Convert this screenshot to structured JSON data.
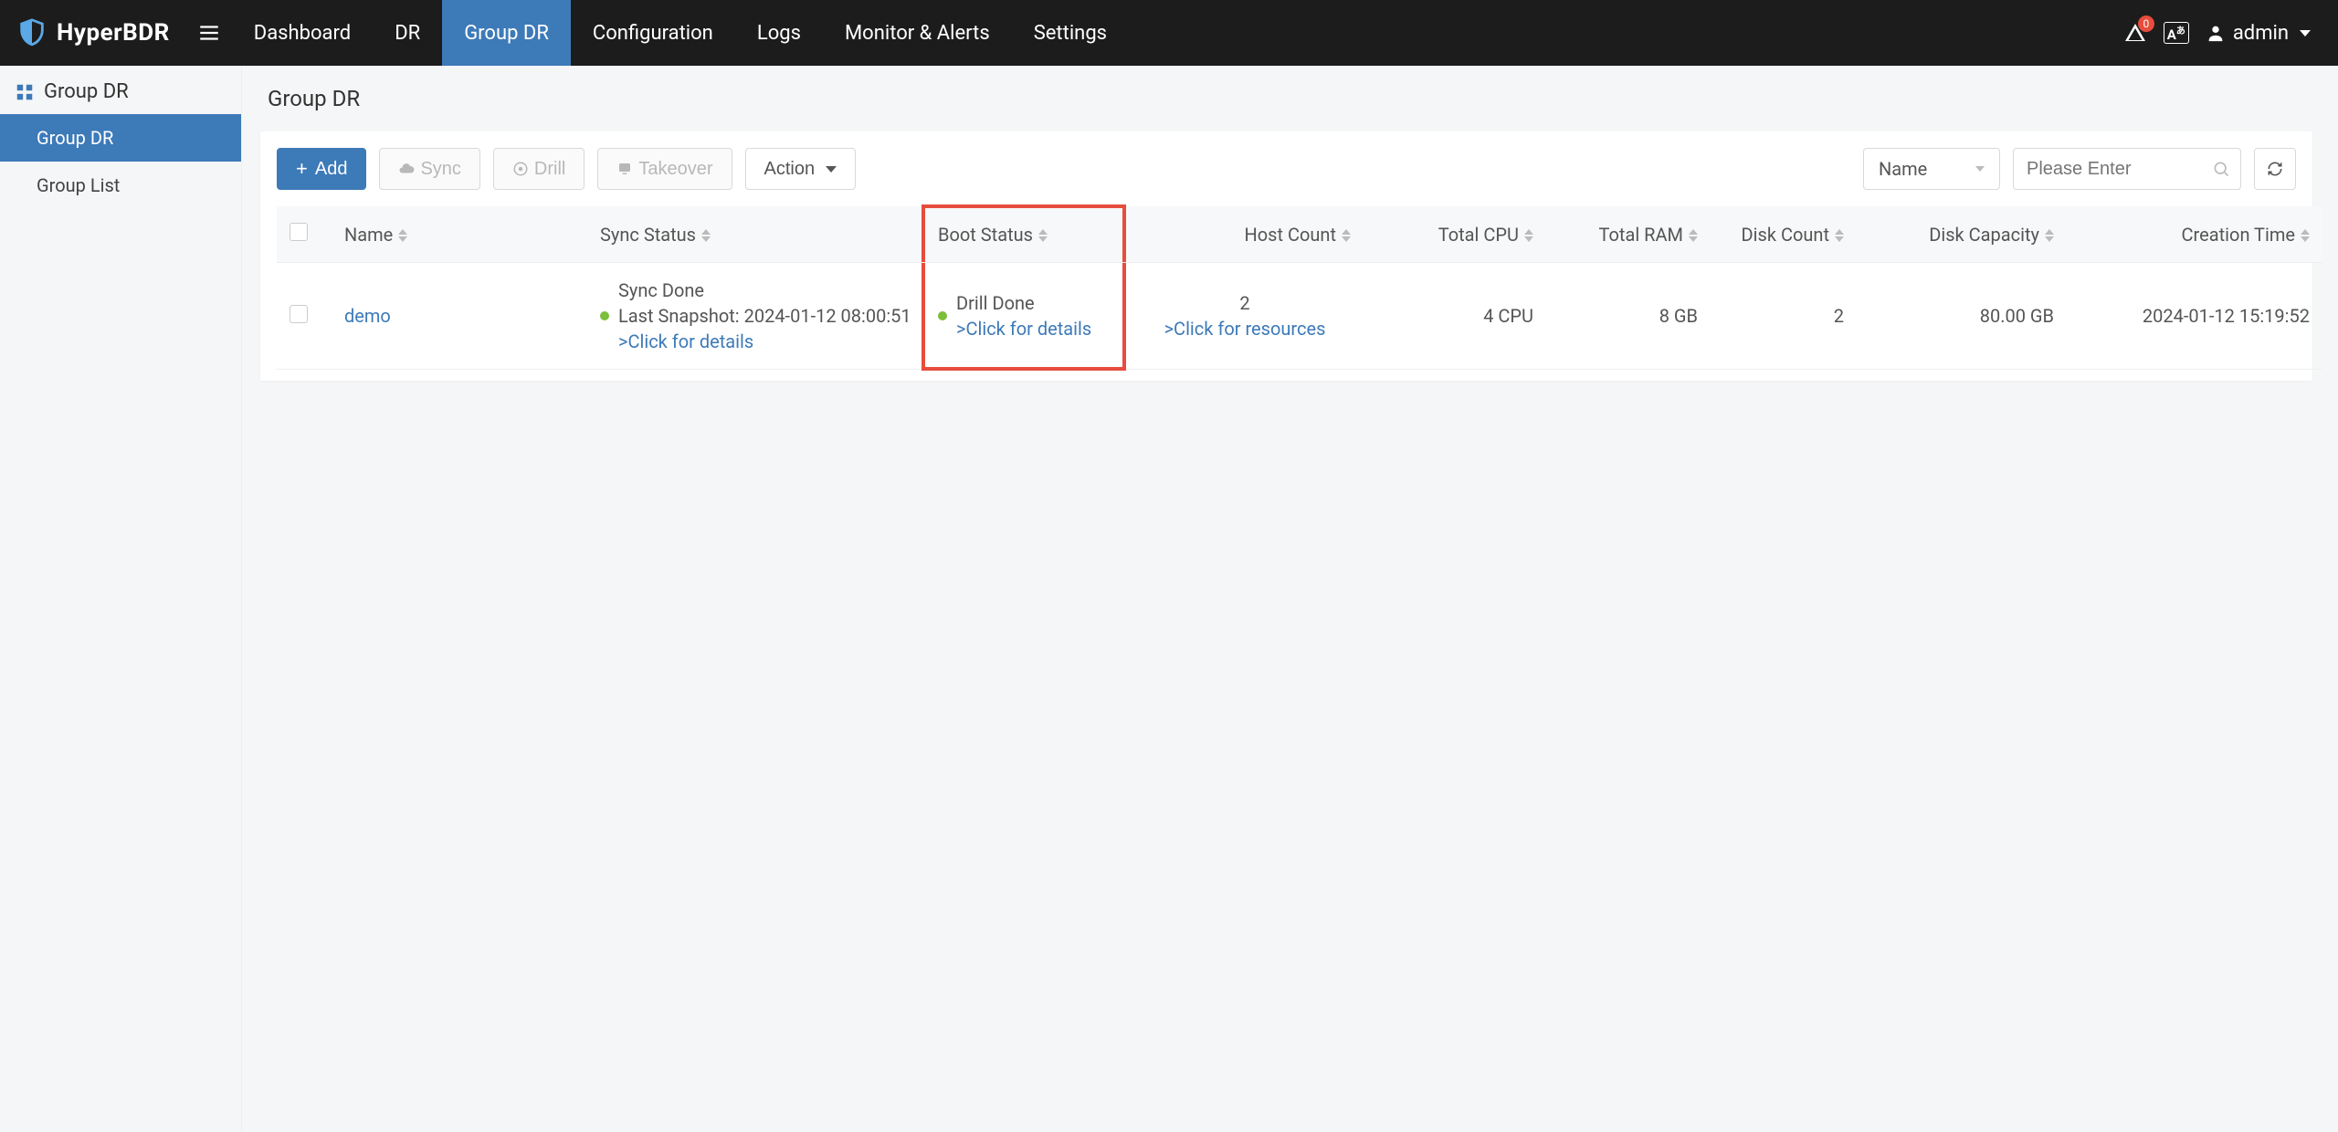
{
  "brand": "HyperBDR",
  "top_nav": {
    "items": [
      "Dashboard",
      "DR",
      "Group DR",
      "Configuration",
      "Logs",
      "Monitor & Alerts",
      "Settings"
    ],
    "active_index": 2
  },
  "notifications_count": "0",
  "lang_badge": "A",
  "user_name": "admin",
  "sidebar": {
    "header": "Group DR",
    "items": [
      {
        "label": "Group DR",
        "active": true
      },
      {
        "label": "Group List",
        "active": false
      }
    ]
  },
  "page_title": "Group DR",
  "toolbar": {
    "add_label": "Add",
    "sync_label": "Sync",
    "drill_label": "Drill",
    "takeover_label": "Takeover",
    "action_label": "Action",
    "filter_field": "Name",
    "search_placeholder": "Please Enter"
  },
  "columns": {
    "name": "Name",
    "sync_status": "Sync Status",
    "boot_status": "Boot Status",
    "host_count": "Host Count",
    "total_cpu": "Total CPU",
    "total_ram": "Total RAM",
    "disk_count": "Disk Count",
    "disk_capacity": "Disk Capacity",
    "creation_time": "Creation Time"
  },
  "rows": [
    {
      "name": "demo",
      "sync_status_line1": "Sync Done",
      "sync_status_line2": "Last Snapshot: 2024-01-12 08:00:51",
      "sync_details_link": ">Click for details",
      "boot_status_line1": "Drill Done",
      "boot_details_link": ">Click for details",
      "host_count_value": "2",
      "host_count_link": ">Click for resources",
      "total_cpu": "4 CPU",
      "total_ram": "8 GB",
      "disk_count": "2",
      "disk_capacity": "80.00 GB",
      "creation_time": "2024-01-12 15:19:52"
    }
  ]
}
